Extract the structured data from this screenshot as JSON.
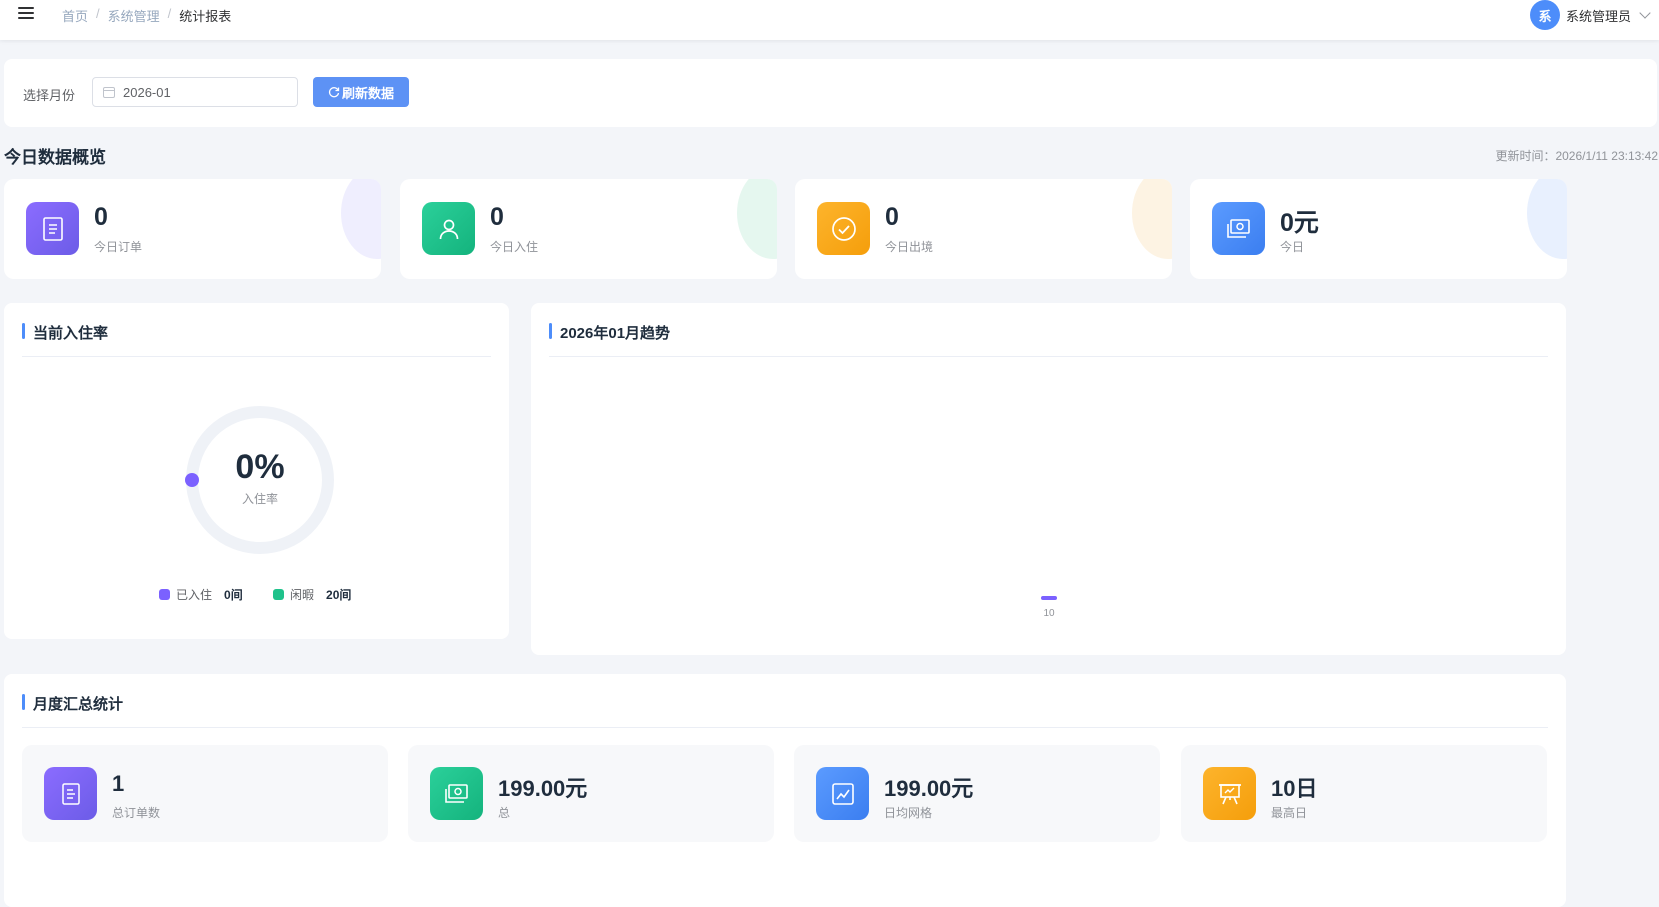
{
  "topbar": {
    "breadcrumb": [
      "首页",
      "系统管理",
      "统计报表"
    ],
    "breadcrumb_sep": "/",
    "user": {
      "avatar_text": "系",
      "name": "系统管理员"
    }
  },
  "filter": {
    "month_label": "选择月份",
    "month_value": "2026-01",
    "refresh_label": "刷新数据"
  },
  "today": {
    "title": "今日数据概览",
    "update_time": "更新时间：2026/1/11 23:13:42",
    "cards": [
      {
        "value": "0",
        "label": "今日订单",
        "icon": "document-icon",
        "color": "#7b61ff"
      },
      {
        "value": "0",
        "label": "今日入住",
        "icon": "user-icon",
        "color": "#1fc28b"
      },
      {
        "value": "0",
        "label": "今日出境",
        "icon": "check-circle-icon",
        "color": "#fbab1c"
      },
      {
        "value": "0元",
        "label": "今日",
        "icon": "money-icon",
        "color": "#4d8dfa"
      }
    ]
  },
  "occupancy": {
    "title": "当前入住率",
    "percent_text": "0%",
    "percent_value": 0,
    "percent_label": "入住率",
    "legend": [
      {
        "name": "已入住",
        "value": "0间",
        "color": "#7b61ff"
      },
      {
        "name": "闲暇",
        "value": "20间",
        "color": "#1fc28b"
      }
    ]
  },
  "trend": {
    "title": "2026年01月趋势"
  },
  "chart_data": {
    "type": "bar",
    "categories": [
      "10"
    ],
    "values": [
      1
    ],
    "series_color": "#7b61ff"
  },
  "monthly": {
    "title": "月度汇总统计",
    "cards": [
      {
        "value": "1",
        "label": "总订单数",
        "icon": "document-icon",
        "color": "#7b61ff"
      },
      {
        "value": "199.00元",
        "label": "总",
        "icon": "money-icon",
        "color": "#1fc28b"
      },
      {
        "value": "199.00元",
        "label": "日均网格",
        "icon": "trend-chart-icon",
        "color": "#4d8dfa"
      },
      {
        "value": "10日",
        "label": "最高日",
        "icon": "presentation-icon",
        "color": "#fbab1c"
      }
    ]
  }
}
